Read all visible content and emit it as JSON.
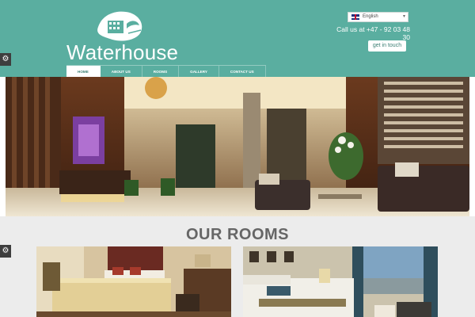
{
  "brand": {
    "name": "Waterhouse",
    "logo_icon": "building-sketch-logo"
  },
  "header": {
    "language": "English",
    "language_flag": "uk-flag-icon",
    "phone": "Call us at +47 - 92 03 48 30",
    "cta_label": "get in touch"
  },
  "nav": {
    "items": [
      {
        "label": "HOME",
        "active": true
      },
      {
        "label": "ABOUT US",
        "active": false
      },
      {
        "label": "ROOMS",
        "active": false
      },
      {
        "label": "GALLERY",
        "active": false
      },
      {
        "label": "CONTACT US",
        "active": false
      }
    ]
  },
  "hero": {
    "image": "hotel-lobby-photo"
  },
  "rooms": {
    "title": "OUR ROOMS",
    "cards": [
      {
        "image": "bedroom-photo-1"
      },
      {
        "image": "bedroom-photo-2"
      }
    ]
  },
  "settings_icon": "gear-icon",
  "colors": {
    "header_teal": "#5aaea0",
    "nav_active_text": "#3c7f74",
    "section_bg": "#ececec",
    "title_gray": "#666666",
    "gear_bg": "#3e3e3e"
  }
}
